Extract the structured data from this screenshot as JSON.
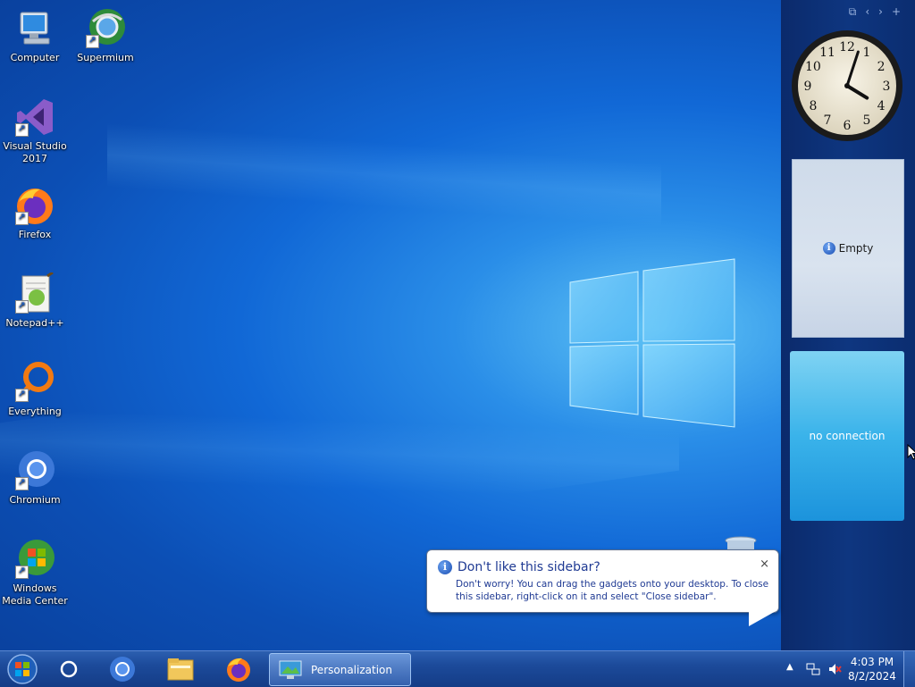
{
  "desktop_icons": [
    {
      "label": "Computer",
      "icon": "computer-icon"
    },
    {
      "label": "Supermium",
      "icon": "supermium-icon"
    },
    {
      "label": "Visual Studio 2017",
      "icon": "visual-studio-icon"
    },
    {
      "label": "Firefox",
      "icon": "firefox-icon"
    },
    {
      "label": "Notepad++",
      "icon": "notepad-plus-plus-icon"
    },
    {
      "label": "Everything",
      "icon": "everything-icon"
    },
    {
      "label": "Chromium",
      "icon": "chromium-icon"
    },
    {
      "label": "Windows Media Center",
      "icon": "windows-media-center-icon"
    }
  ],
  "sidebar": {
    "toolbar_icons": [
      "restore-icon",
      "previous-icon",
      "next-icon",
      "add-gadget-icon"
    ],
    "gadget_empty_label": "Empty",
    "gadget_weather_label": "no connection",
    "clock": {
      "hour": 4,
      "minute": 3
    }
  },
  "balloon": {
    "title": "Don't like this sidebar?",
    "body": "Don't worry! You can drag the gadgets onto your desktop. To close this sidebar, right-click on it and select \"Close sidebar\".",
    "close_glyph": "×"
  },
  "taskbar": {
    "pinned": [
      "cortana-icon",
      "chromium-icon",
      "file-explorer-icon",
      "firefox-icon"
    ],
    "active_task": {
      "label": "Personalization",
      "icon": "personalization-icon"
    },
    "tray_icons": [
      "show-hidden-icons-icon",
      "network-icon",
      "volume-muted-icon"
    ],
    "time": "4:03 PM",
    "date": "8/2/2024"
  },
  "colors": {
    "desktop_blue": "#1168d6",
    "sidebar_bg": "#0e3680",
    "taskbar_bg": "#1c4a9a",
    "balloon_text": "#1f3a93"
  }
}
